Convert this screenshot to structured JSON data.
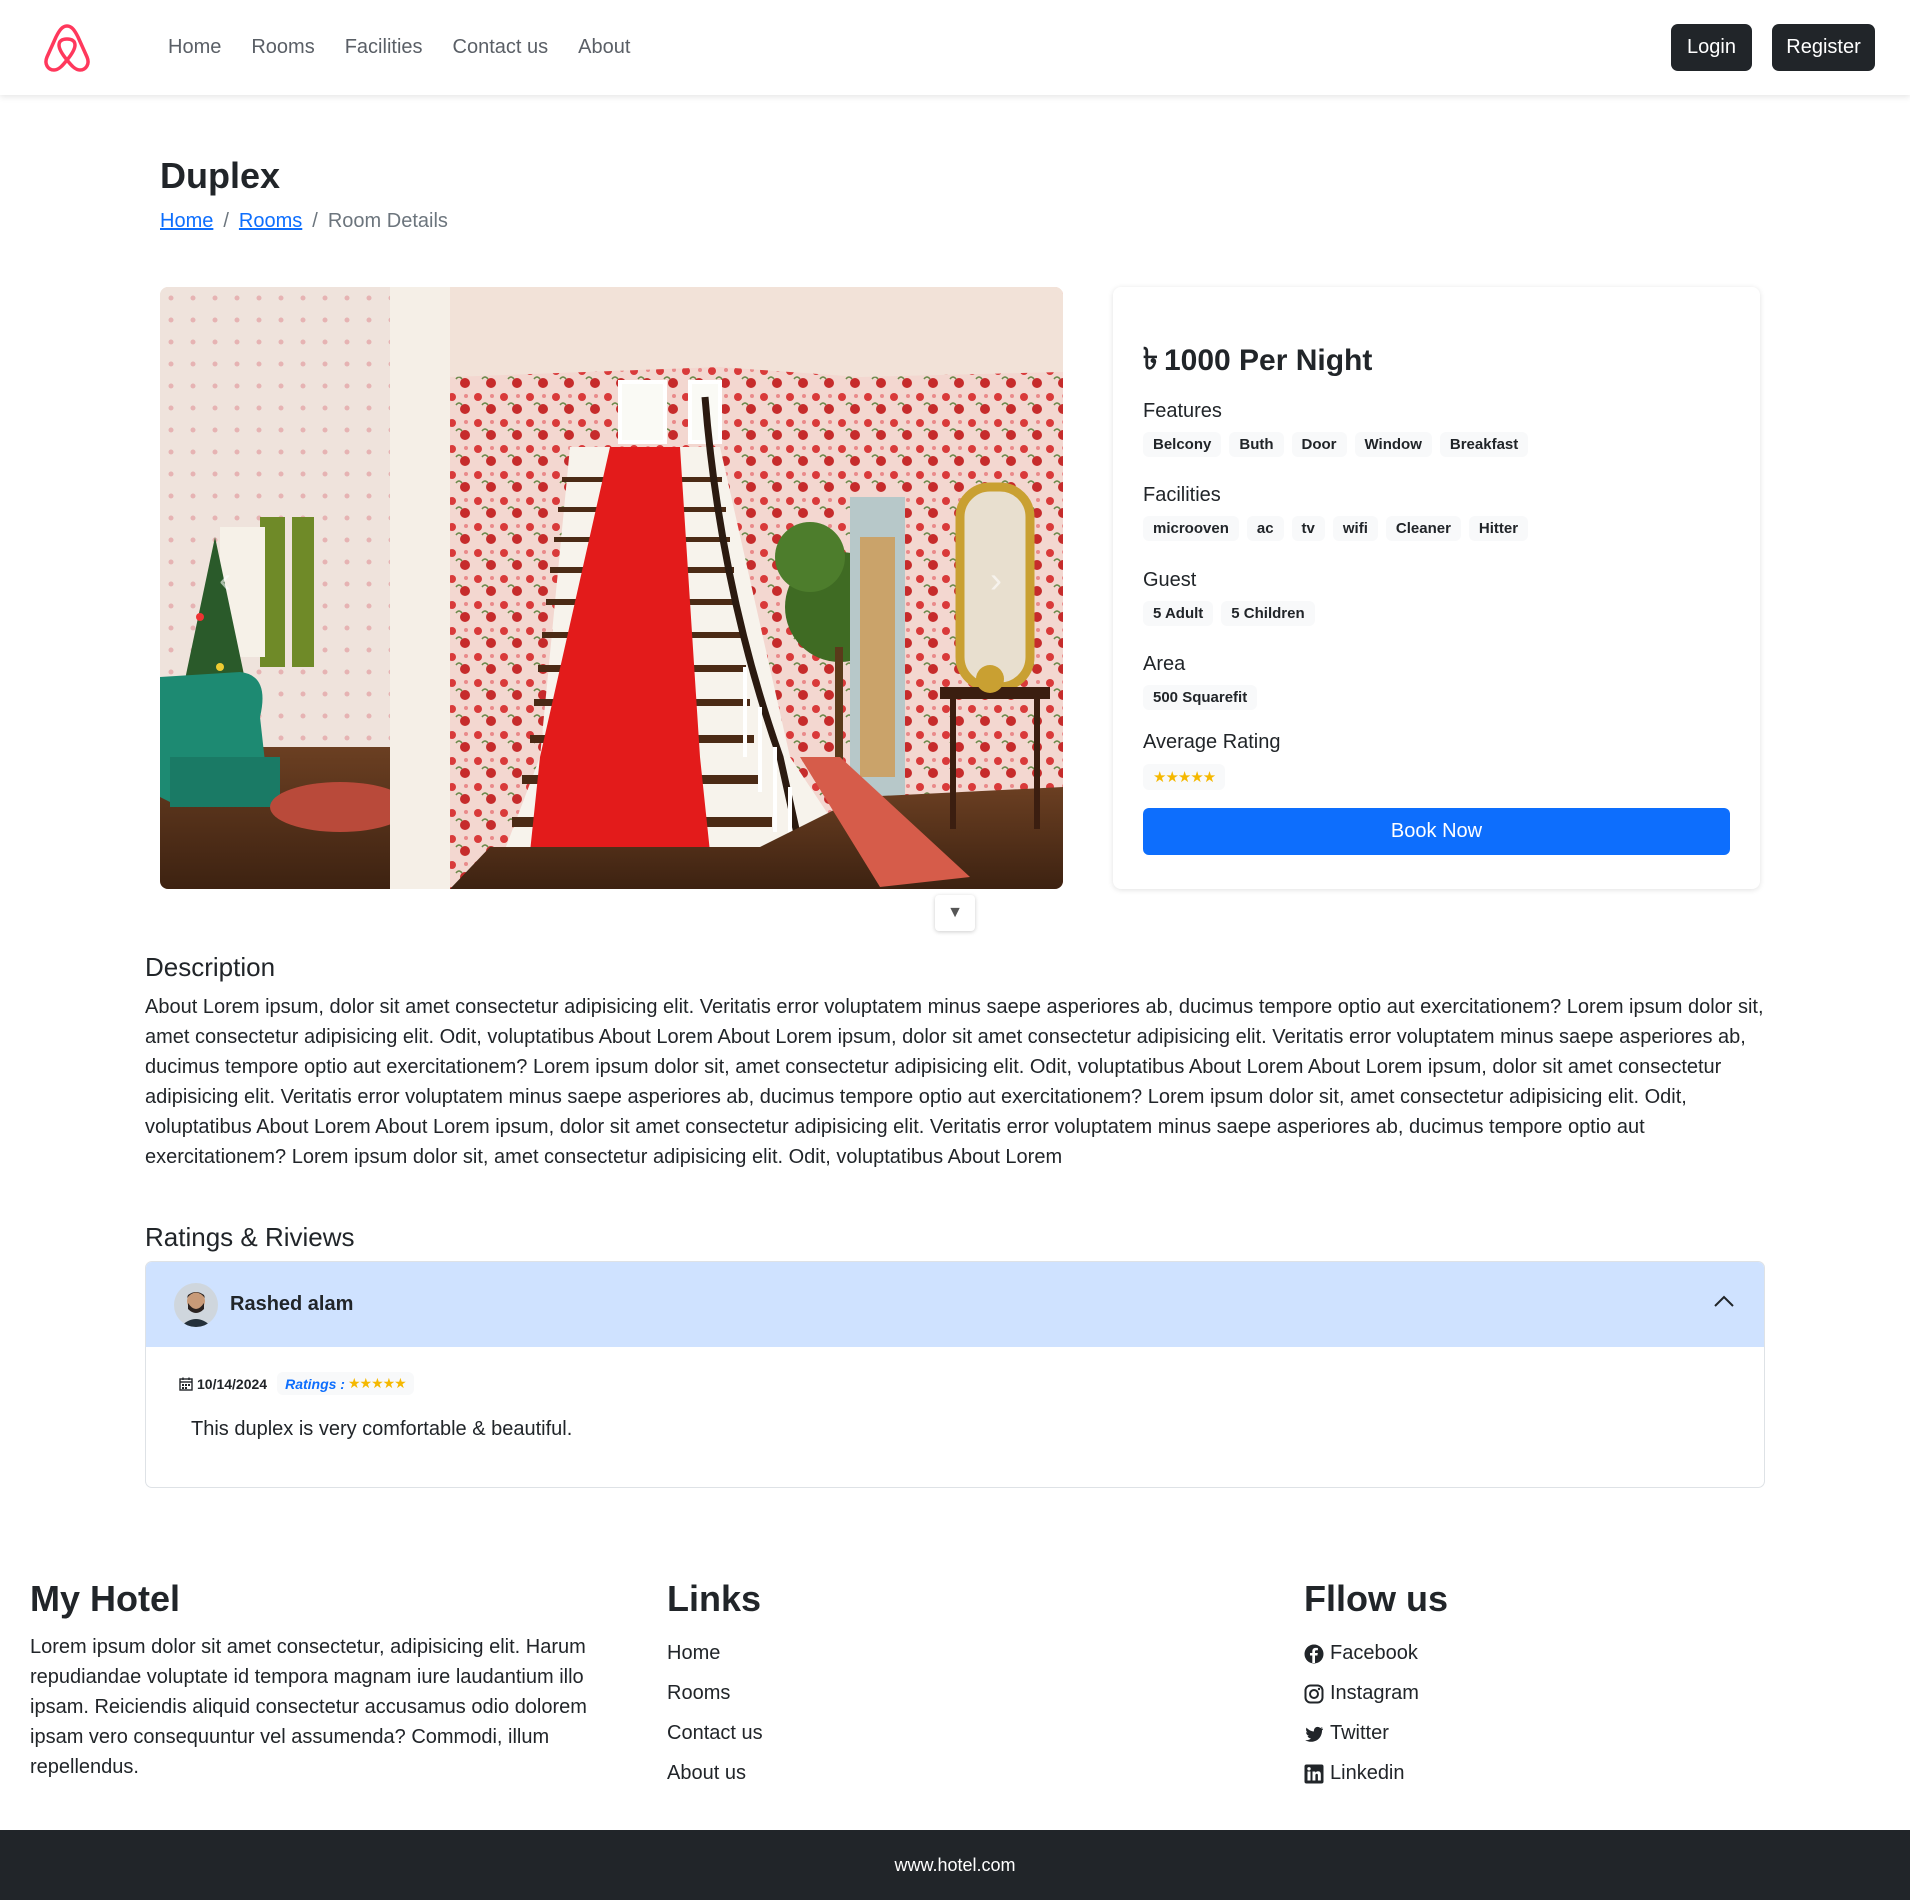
{
  "navbar": {
    "links": [
      "Home",
      "Rooms",
      "Facilities",
      "Contact us",
      "About"
    ],
    "login_label": "Login",
    "register_label": "Register",
    "brand_color": "#ff385c"
  },
  "room": {
    "title": "Duplex",
    "breadcrumb": [
      "Home",
      "Rooms",
      "Room Details"
    ],
    "price_text": "1000 Per Night",
    "currency_symbol": "৳",
    "features_heading": "Features",
    "features": [
      "Belcony",
      "Buth",
      "Door",
      "Window",
      "Breakfast"
    ],
    "facilities_heading": "Facilities",
    "facilities": [
      "microoven",
      "ac",
      "tv",
      "wifi",
      "Cleaner",
      "Hitter"
    ],
    "guest_heading": "Guest",
    "guests": [
      "5 Adult",
      "5 Children"
    ],
    "area_heading": "Area",
    "area": [
      "500 Squarefit"
    ],
    "rating_heading": "Average Rating",
    "average_rating": 5,
    "book_label": "Book Now"
  },
  "description": {
    "heading": "Description",
    "text": "About Lorem ipsum, dolor sit amet consectetur adipisicing elit. Veritatis error voluptatem minus saepe asperiores ab, ducimus tempore optio aut exercitationem? Lorem ipsum dolor sit, amet consectetur adipisicing elit. Odit, voluptatibus About Lorem About Lorem ipsum, dolor sit amet consectetur adipisicing elit. Veritatis error voluptatem minus saepe asperiores ab, ducimus tempore optio aut exercitationem? Lorem ipsum dolor sit, amet consectetur adipisicing elit. Odit, voluptatibus About Lorem About Lorem ipsum, dolor sit amet consectetur adipisicing elit. Veritatis error voluptatem minus saepe asperiores ab, ducimus tempore optio aut exercitationem? Lorem ipsum dolor sit, amet consectetur adipisicing elit. Odit, voluptatibus About Lorem About Lorem ipsum, dolor sit amet consectetur adipisicing elit. Veritatis error voluptatem minus saepe asperiores ab, ducimus tempore optio aut exercitationem? Lorem ipsum dolor sit, amet consectetur adipisicing elit. Odit, voluptatibus About Lorem"
  },
  "reviews": {
    "heading": "Ratings & Riviews",
    "items": [
      {
        "name": "Rashed alam",
        "date": "10/14/2024",
        "ratings_label": "Ratings :",
        "rating": 5,
        "text": "This duplex is very comfortable & beautiful."
      }
    ]
  },
  "footer": {
    "brand_heading": "My Hotel",
    "about": "Lorem ipsum dolor sit amet consectetur, adipisicing elit. Harum repudiandae voluptate id tempora magnam iure laudantium illo ipsam. Reiciendis aliquid consectetur accusamus odio dolorem ipsam vero consequuntur vel assumenda? Commodi, illum repellendus.",
    "links_heading": "Links",
    "links": [
      "Home",
      "Rooms",
      "Contact us",
      "About us"
    ],
    "follow_heading": "Fllow us",
    "social": [
      "Facebook",
      "Instagram",
      "Twitter",
      "Linkedin"
    ],
    "copyright": "www.hotel.com"
  },
  "icons": {
    "logo": "airbnb-logo-icon",
    "carousel_prev": "chevron-left-icon",
    "carousel_next": "chevron-right-icon",
    "scroll": "arrow-down-icon",
    "accordion": "chevron-up-icon",
    "date": "calendar-icon",
    "star": "star-icon"
  }
}
